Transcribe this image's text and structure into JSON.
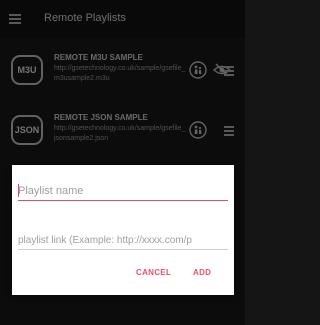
{
  "appbar": {
    "title": "Remote Playlists"
  },
  "playlists": [
    {
      "badge": "M3U",
      "name": "REMOTE M3U SAMPLE",
      "url": "http://gsetechnology.co.uk/sample/gsefile_m3usample2.m3u"
    },
    {
      "badge": "JSON",
      "name": "REMOTE JSON SAMPLE",
      "url": "http://gsetechnology.co.uk/sample/gsefile_jsonsample2.json"
    }
  ],
  "dialog": {
    "name_placeholder": "Playlist name",
    "link_placeholder": "playlist link (Example: http://xxxx.com/p",
    "cancel_label": "CANCEL",
    "add_label": "ADD"
  },
  "colors": {
    "accent": "#ea4f6b",
    "background": "#151515"
  }
}
